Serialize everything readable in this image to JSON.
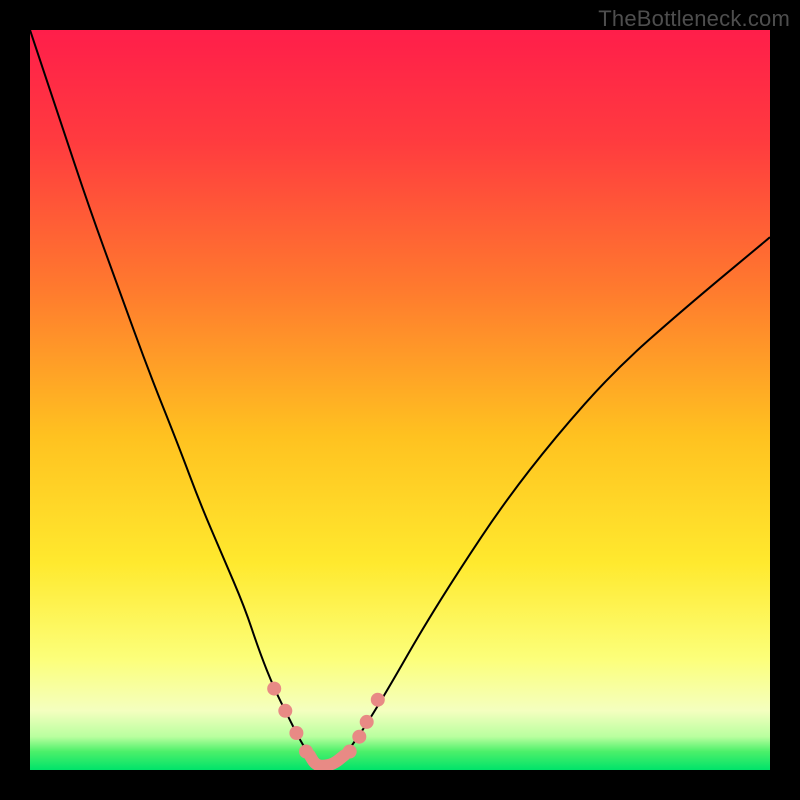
{
  "watermark": "TheBottleneck.com",
  "chart_data": {
    "type": "line",
    "title": "",
    "xlabel": "",
    "ylabel": "",
    "xlim": [
      0,
      100
    ],
    "ylim": [
      0,
      100
    ],
    "grid": false,
    "legend": false,
    "background_gradient": {
      "stops": [
        {
          "offset": 0.0,
          "color": "#ff1e4a"
        },
        {
          "offset": 0.15,
          "color": "#ff3b3f"
        },
        {
          "offset": 0.35,
          "color": "#ff7a2e"
        },
        {
          "offset": 0.55,
          "color": "#ffc220"
        },
        {
          "offset": 0.72,
          "color": "#ffe92e"
        },
        {
          "offset": 0.85,
          "color": "#fcff7a"
        },
        {
          "offset": 0.92,
          "color": "#f4ffbf"
        },
        {
          "offset": 0.955,
          "color": "#b9ff9f"
        },
        {
          "offset": 0.975,
          "color": "#4cf06a"
        },
        {
          "offset": 1.0,
          "color": "#00e36a"
        }
      ]
    },
    "series": [
      {
        "name": "left-curve",
        "color": "#000000",
        "width": 2,
        "x": [
          0,
          4,
          8,
          12,
          16,
          20,
          23,
          26,
          29,
          31,
          33,
          35,
          36.5,
          37.8
        ],
        "y": [
          100,
          88,
          76,
          65,
          54,
          44,
          36,
          29,
          22,
          16,
          11,
          7,
          4,
          2
        ]
      },
      {
        "name": "right-curve",
        "color": "#000000",
        "width": 2,
        "x": [
          42.5,
          44,
          46,
          49,
          53,
          58,
          64,
          71,
          79,
          88,
          100
        ],
        "y": [
          2,
          4,
          7,
          12,
          19,
          27,
          36,
          45,
          54,
          62,
          72
        ]
      },
      {
        "name": "pink-floor",
        "color": "#e88a85",
        "width": 12,
        "linecap": "round",
        "x": [
          37.8,
          38.5,
          39.5,
          41,
          42.5
        ],
        "y": [
          2,
          0.8,
          0.5,
          0.8,
          2
        ]
      }
    ],
    "markers": {
      "name": "pink-dots",
      "color": "#e88a85",
      "radius": 7,
      "points": [
        {
          "x": 33.0,
          "y": 11.0
        },
        {
          "x": 34.5,
          "y": 8.0
        },
        {
          "x": 36.0,
          "y": 5.0
        },
        {
          "x": 37.3,
          "y": 2.5
        },
        {
          "x": 43.2,
          "y": 2.5
        },
        {
          "x": 44.5,
          "y": 4.5
        },
        {
          "x": 45.5,
          "y": 6.5
        },
        {
          "x": 47.0,
          "y": 9.5
        }
      ]
    }
  }
}
